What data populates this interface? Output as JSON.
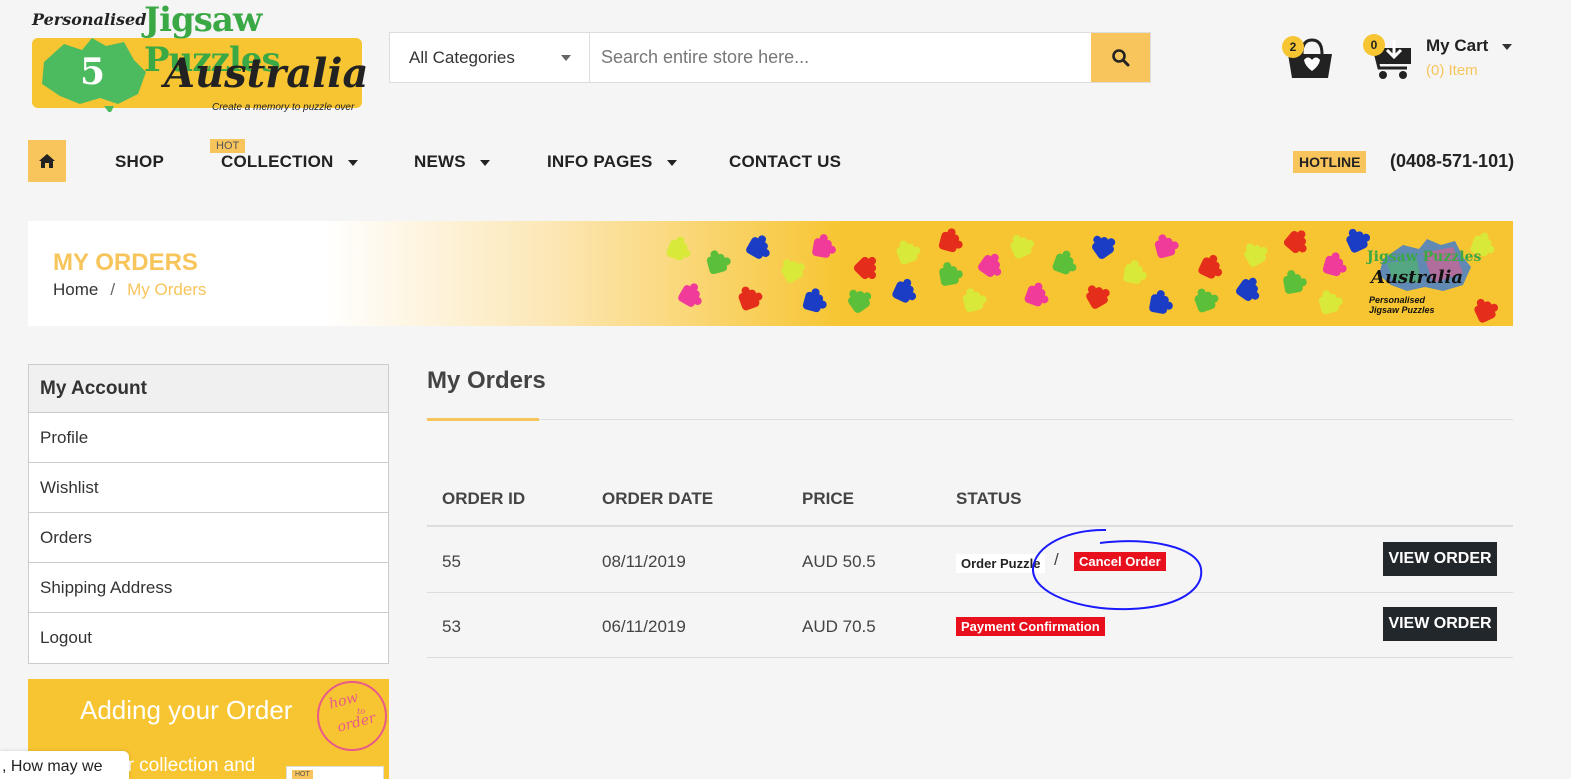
{
  "logo": {
    "line1": "Personalised",
    "line2": "Jigsaw Puzzles",
    "line3": "Australia",
    "tagline": "Create a memory to puzzle over"
  },
  "search": {
    "category": "All Categories",
    "placeholder": "Search entire store here...",
    "button_icon": "search-icon"
  },
  "wishlist": {
    "count": "2",
    "icon": "bag-heart-icon"
  },
  "cart": {
    "count": "0",
    "title": "My Cart",
    "items": "(0) Item",
    "icon": "cart-icon"
  },
  "nav": {
    "home_icon": "home-icon",
    "items": [
      {
        "label": "SHOP"
      },
      {
        "label": "COLLECTION",
        "badge": "HOT"
      },
      {
        "label": "NEWS"
      },
      {
        "label": "INFO PAGES"
      },
      {
        "label": "CONTACT US"
      }
    ],
    "hotline_label": "HOTLINE",
    "hotline_number": "(0408-571-101)"
  },
  "banner": {
    "title": "MY ORDERS",
    "breadcrumb": {
      "home": "Home",
      "separator": "/",
      "current": "My Orders"
    },
    "logo_line1": "Jigsaw Puzzles",
    "logo_line2": "Australia",
    "logo_line3": "Personalised Jigsaw Puzzles"
  },
  "sidebar": {
    "title": "My Account",
    "items": [
      {
        "label": "Profile"
      },
      {
        "label": "Wishlist"
      },
      {
        "label": "Orders"
      },
      {
        "label": "Shipping Address"
      },
      {
        "label": "Logout"
      }
    ]
  },
  "promo": {
    "title": "Adding your Order",
    "subtitle": "ur collection and",
    "circle_line1": "how",
    "circle_line2": "to",
    "circle_line3": "order",
    "hot": "HOT"
  },
  "chat": {
    "text": ", How may we"
  },
  "main": {
    "title": "My Orders",
    "columns": [
      "ORDER ID",
      "ORDER DATE",
      "PRICE",
      "STATUS"
    ],
    "orders": [
      {
        "id": "55",
        "date": "08/11/2019",
        "price": "AUD 50.5",
        "status": "Order Puzzle",
        "separator": "/",
        "action_status": "Cancel Order",
        "button": "VIEW ORDER"
      },
      {
        "id": "53",
        "date": "06/11/2019",
        "price": "AUD 70.5",
        "status_red": "Payment Confirmation",
        "button": "VIEW ORDER"
      }
    ]
  },
  "colors": {
    "accent": "#f7c55c",
    "brand_yellow": "#f7c531",
    "status_red": "#e8101c",
    "button_dark": "#22272b",
    "annotation_blue": "#1a1aff"
  }
}
